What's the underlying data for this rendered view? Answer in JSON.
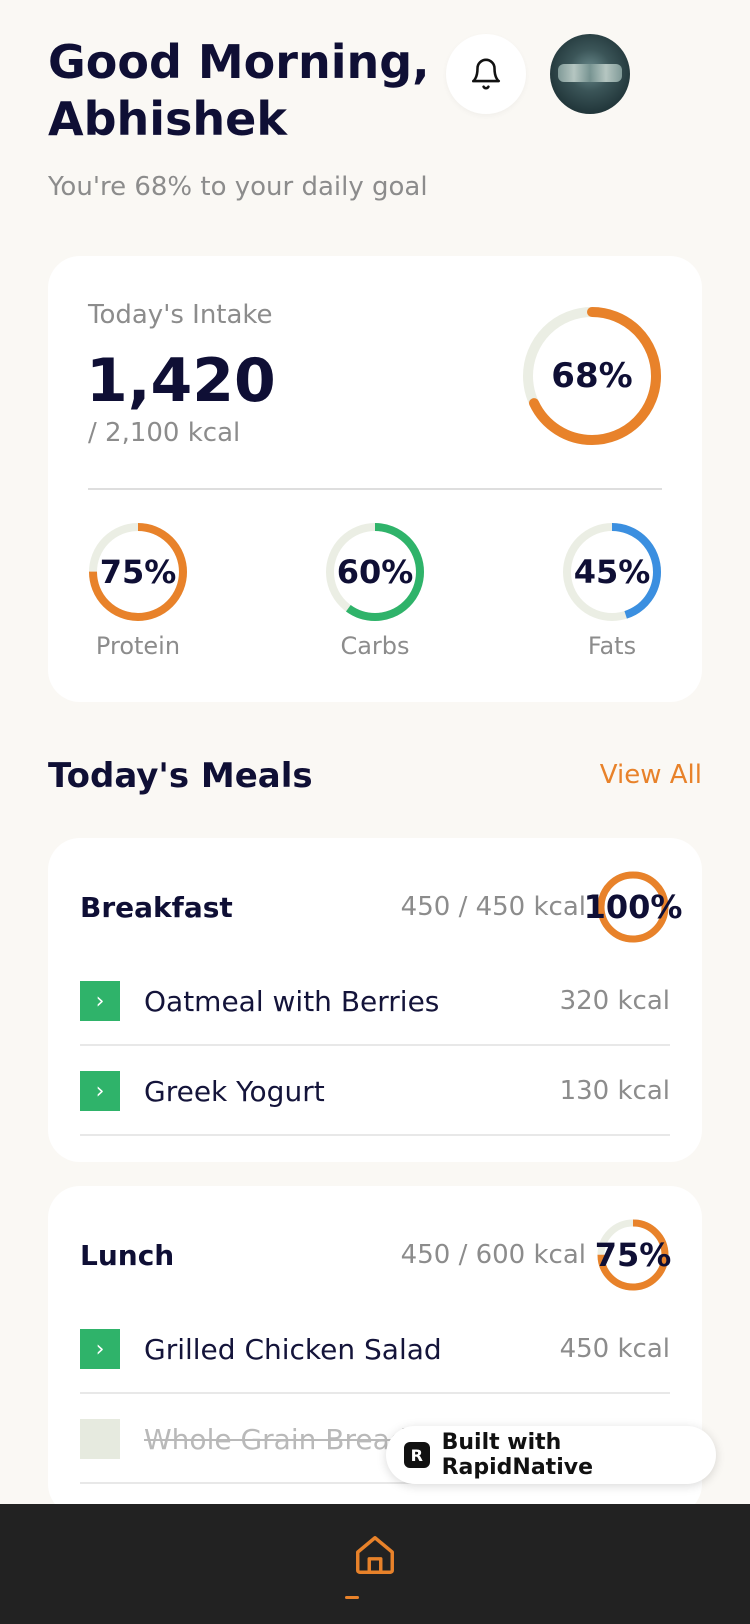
{
  "header": {
    "greeting": "Good Morning, Abhishek",
    "subtitle": "You're 68% to your daily goal"
  },
  "intake": {
    "label": "Today's Intake",
    "value": "1,420",
    "goal": "/ 2,100 kcal",
    "percent_label": "68%",
    "percent": 0.68,
    "color": "#e8822a",
    "track_color": "#ebeee4"
  },
  "macros": [
    {
      "name": "Protein",
      "percent_label": "75%",
      "percent": 0.75,
      "color": "#e8822a"
    },
    {
      "name": "Carbs",
      "percent_label": "60%",
      "percent": 0.6,
      "color": "#2fb36a"
    },
    {
      "name": "Fats",
      "percent_label": "45%",
      "percent": 0.45,
      "color": "#3b8fe0"
    }
  ],
  "meals_section": {
    "title": "Today's Meals",
    "view_all": "View All"
  },
  "meals": [
    {
      "name": "Breakfast",
      "kcal": "450 / 450 kcal",
      "percent_label": "100%",
      "percent": 1.0,
      "items": [
        {
          "name": "Oatmeal with Berries",
          "kcal": "320 kcal",
          "done": true
        },
        {
          "name": "Greek Yogurt",
          "kcal": "130 kcal",
          "done": true
        }
      ]
    },
    {
      "name": "Lunch",
      "kcal": "450 / 600 kcal",
      "percent_label": "75%",
      "percent": 0.75,
      "items": [
        {
          "name": "Grilled Chicken Salad",
          "kcal": "450 kcal",
          "done": true
        },
        {
          "name": "Whole Grain Bread",
          "kcal": "",
          "done": false
        }
      ]
    }
  ],
  "badge": {
    "text": "Built with RapidNative",
    "logo": "R"
  },
  "icons": {
    "bell": "bell-icon",
    "home": "home-icon",
    "check": "chevron-right-icon"
  },
  "colors": {
    "accent": "#e8822a",
    "green": "#2fb36a",
    "blue": "#3b8fe0",
    "dark": "#0f0f35"
  }
}
